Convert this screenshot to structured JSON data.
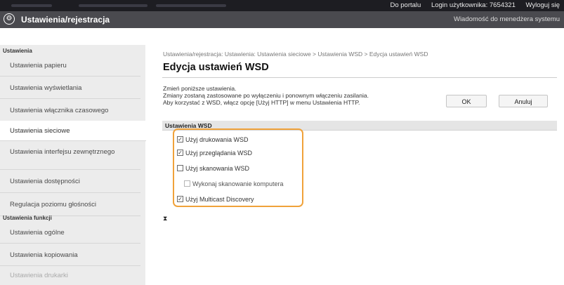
{
  "topbar": {
    "portal_link": "Do portalu",
    "login_label": "Login użytkownika:",
    "login_value": "7654321",
    "logout_link": "Wyloguj się"
  },
  "titlebar": {
    "logo_glyph": "⚙",
    "title": "Ustawienia/rejestracja",
    "admin_message": "Wiadomość do menedżera systemu"
  },
  "sidebar": {
    "section1": "Ustawienia",
    "items1": [
      "Ustawienia papieru",
      "Ustawienia wyświetlania",
      "Ustawienia włącznika czasowego",
      "Ustawienia sieciowe",
      "Ustawienia interfejsu zewnętrznego",
      "Ustawienia dostępności",
      "Regulacja poziomu głośności"
    ],
    "section2": "Ustawienia funkcji",
    "items2": [
      "Ustawienia ogólne",
      "Ustawienia kopiowania",
      "Ustawienia drukarki"
    ]
  },
  "main": {
    "breadcrumb": "Ustawienia/rejestracja: Ustawienia: Ustawienia sieciowe > Ustawienia WSD > Edycja ustawień WSD",
    "title": "Edycja ustawień WSD",
    "desc_lines": [
      "Zmień poniższe ustawienia.",
      "Zmiany zostaną zastosowane po wyłączeniu i ponownym włączeniu zasilania.",
      "Aby korzystać z WSD, włącz opcję [Użyj HTTP] w menu Ustawienia HTTP."
    ],
    "ok_label": "OK",
    "cancel_label": "Anuluj",
    "section_title": "Ustawienia WSD",
    "options": [
      {
        "label": "Użyj drukowania WSD",
        "checked": "✓"
      },
      {
        "label": "Użyj przeglądania WSD",
        "checked": "✓"
      },
      {
        "label": "Użyj skanowania WSD",
        "checked": ""
      },
      {
        "label": "Wykonaj skanowanie komputera",
        "checked": ""
      },
      {
        "label": "Użyj Multicast Discovery",
        "checked": "✓"
      }
    ],
    "collapse_glyph": "⧗"
  },
  "colors": {
    "highlight": "#f0a23a",
    "titlebar": "#4a4a4f"
  }
}
